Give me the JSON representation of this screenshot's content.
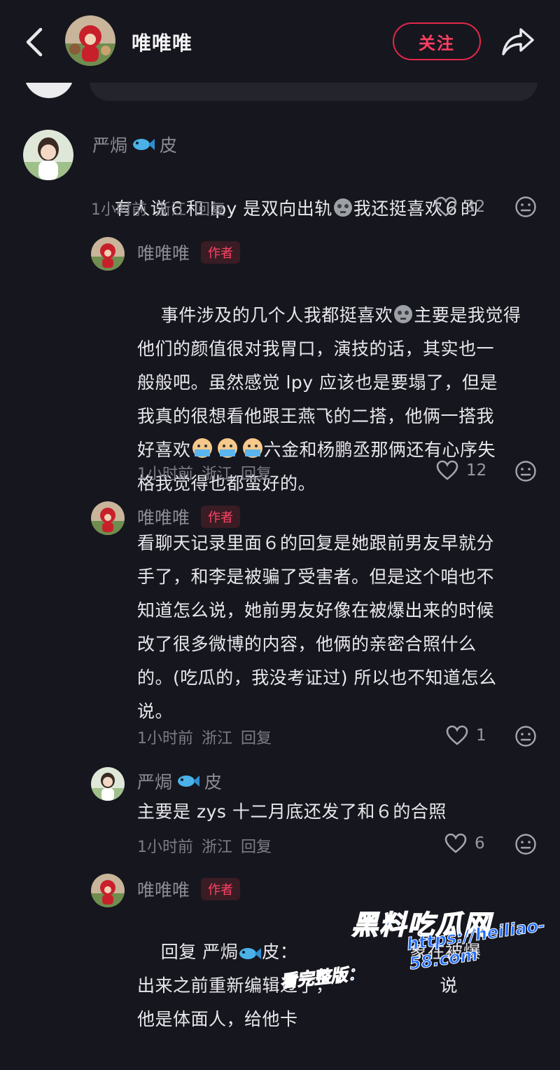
{
  "header": {
    "title": "唯唯唯",
    "follow_label": "关注"
  },
  "comments": [
    {
      "user": "严焗",
      "user_suffix": "皮",
      "text_a": "有人说６和 lpy 是双向出轨",
      "text_b": "我还挺喜欢６的",
      "time": "1小时前",
      "location": "浙江",
      "reply": "回复",
      "likes": "32"
    },
    {
      "user": "唯唯唯",
      "badge": "作者",
      "text_a": "事件涉及的几个人我都挺喜欢",
      "text_b": "主要是我觉得\n他们的颜值很对我胃口，演技的话，其实也一\n般般吧。虽然感觉 lpy 应该也是要塌了，但是\n我真的很想看他跟王燕飞的二搭，他俩一搭我\n好喜欢",
      "text_c": "六金和杨鹏丞那俩还有心序失\n格我觉得也都蛮好的。",
      "time": "1小时前",
      "location": "浙江",
      "reply": "回复",
      "likes": "12"
    },
    {
      "user": "唯唯唯",
      "badge": "作者",
      "text": "看聊天记录里面６的回复是她跟前男友早就分\n手了，和李是被骗了受害者。但是这个咱也不\n知道怎么说，她前男友好像在被爆出来的时候\n改了很多微博的内容，他俩的亲密合照什么\n的。(吃瓜的，我没考证过) 所以也不知道怎么\n说。",
      "time": "1小时前",
      "location": "浙江",
      "reply": "回复",
      "likes": "1"
    },
    {
      "user": "严焗",
      "user_suffix": "皮",
      "text": "主要是 zys 十二月底还发了和６的合照",
      "time": "1小时前",
      "location": "浙江",
      "reply": "回复",
      "likes": "6"
    },
    {
      "user": "唯唯唯",
      "badge": "作者",
      "reply_prefix": "回复 严焗",
      "reply_suffix": "皮：",
      "text": "象在被爆\n出来之前重新编辑过了，                  说\n他是体面人，给他",
      "text_tail": "卡"
    }
  ],
  "watermark": {
    "brand": "黑料吃瓜网",
    "url": "https://heiliao-58.com",
    "cta": "看完整版："
  }
}
